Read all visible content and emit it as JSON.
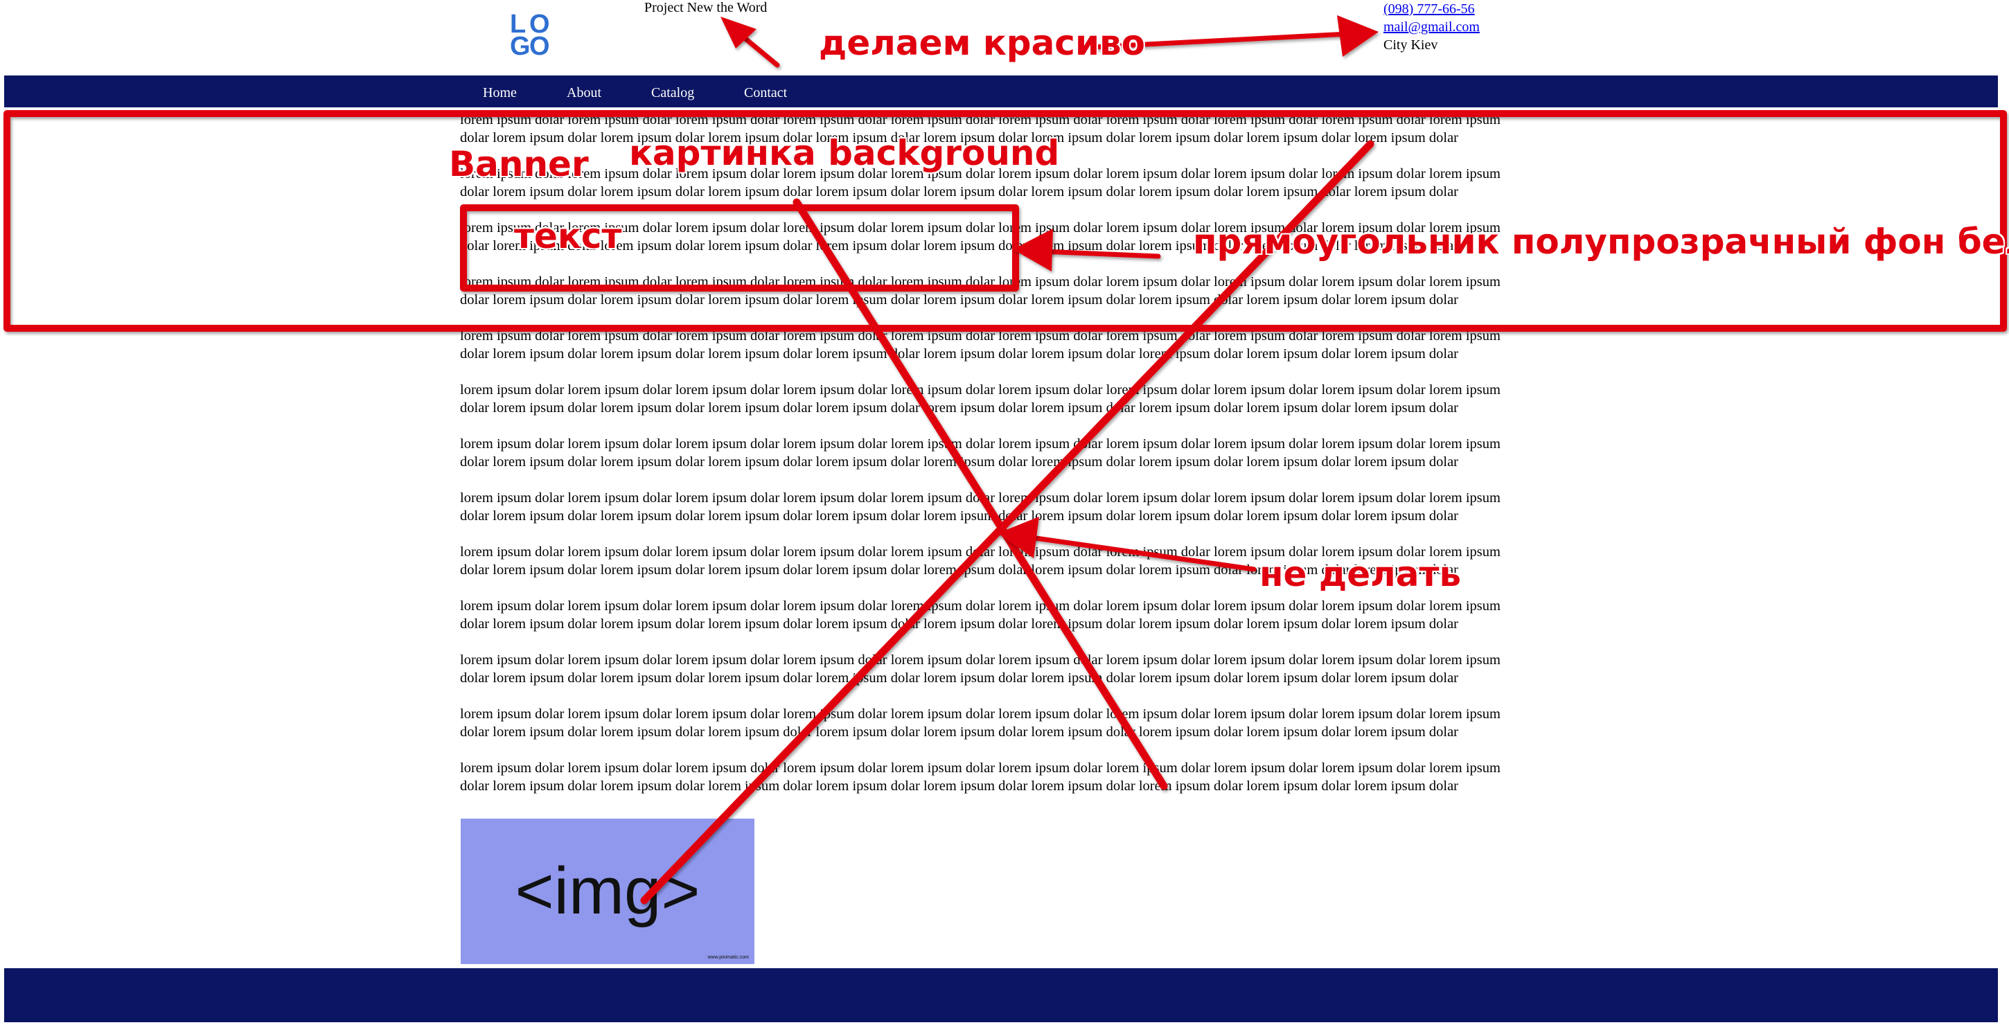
{
  "header": {
    "logo_letters": [
      "L",
      "O",
      "G",
      "O"
    ],
    "site_title": "Project New the Word",
    "phone": "(098) 777-66-56",
    "email": "mail@gmail.com",
    "city": "City Kiev"
  },
  "nav": {
    "items": [
      {
        "label": "Home"
      },
      {
        "label": "About"
      },
      {
        "label": "Catalog"
      },
      {
        "label": "Contact"
      }
    ]
  },
  "content": {
    "paragraph_text": "lorem ipsum dolar lorem ipsum dolar lorem ipsum dolar lorem ipsum dolar lorem ipsum dolar lorem ipsum dolar lorem ipsum dolar lorem ipsum dolar lorem ipsum dolar lorem ipsum dolar lorem ipsum dolar lorem ipsum dolar lorem ipsum dolar lorem ipsum dolar lorem ipsum dolar lorem ipsum dolar lorem ipsum dolar lorem ipsum dolar lorem ipsum dolar",
    "paragraph_count": 13
  },
  "image_placeholder": {
    "label": "<img>",
    "credit": "www.pinimatic.com"
  },
  "annotations": {
    "make_pretty": "делаем красиво",
    "banner": "Banner",
    "background_picture": "картинка background",
    "text": "текст",
    "rectangle": "прямоугольник полупрозрачный фон белый",
    "do_not": "не делать",
    "color": "#e0000f"
  }
}
